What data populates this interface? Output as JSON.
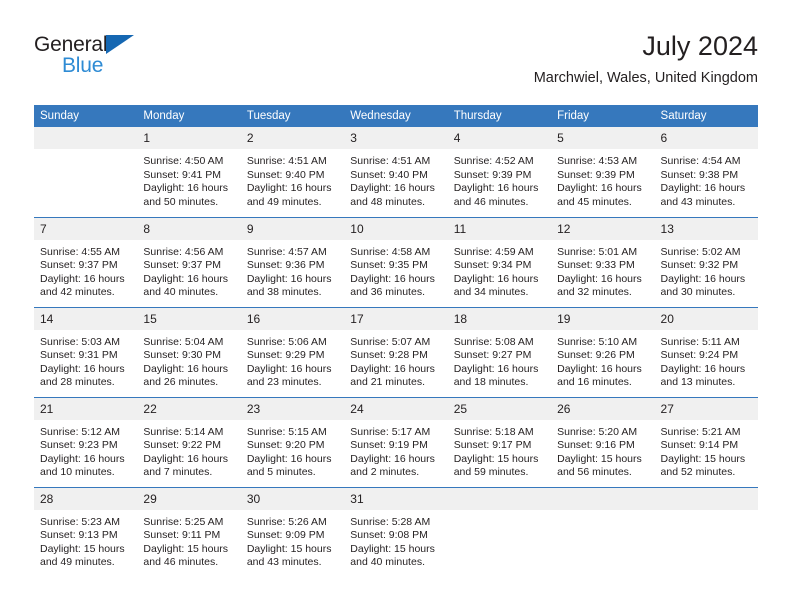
{
  "brand": {
    "name_top": "General",
    "name_bottom": "Blue",
    "triangle_color": "#1567b2",
    "blue_text_color": "#2e8bd4"
  },
  "header": {
    "month_year": "July 2024",
    "location": "Marchwiel, Wales, United Kingdom"
  },
  "theme": {
    "header_bg": "#3678bd",
    "header_text": "#ffffff",
    "daynum_bg": "#f0f0f0",
    "cell_bg": "#ffffff",
    "text": "#231f20",
    "row_divider": "#3678bd"
  },
  "weekday_headers": [
    "Sunday",
    "Monday",
    "Tuesday",
    "Wednesday",
    "Thursday",
    "Friday",
    "Saturday"
  ],
  "weeks": [
    {
      "days": [
        {
          "day": "",
          "sunrise": "",
          "sunset": "",
          "daylight_1": "",
          "daylight_2": "",
          "blank": true
        },
        {
          "day": "1",
          "sunrise": "Sunrise: 4:50 AM",
          "sunset": "Sunset: 9:41 PM",
          "daylight_1": "Daylight: 16 hours",
          "daylight_2": "and 50 minutes."
        },
        {
          "day": "2",
          "sunrise": "Sunrise: 4:51 AM",
          "sunset": "Sunset: 9:40 PM",
          "daylight_1": "Daylight: 16 hours",
          "daylight_2": "and 49 minutes."
        },
        {
          "day": "3",
          "sunrise": "Sunrise: 4:51 AM",
          "sunset": "Sunset: 9:40 PM",
          "daylight_1": "Daylight: 16 hours",
          "daylight_2": "and 48 minutes."
        },
        {
          "day": "4",
          "sunrise": "Sunrise: 4:52 AM",
          "sunset": "Sunset: 9:39 PM",
          "daylight_1": "Daylight: 16 hours",
          "daylight_2": "and 46 minutes."
        },
        {
          "day": "5",
          "sunrise": "Sunrise: 4:53 AM",
          "sunset": "Sunset: 9:39 PM",
          "daylight_1": "Daylight: 16 hours",
          "daylight_2": "and 45 minutes."
        },
        {
          "day": "6",
          "sunrise": "Sunrise: 4:54 AM",
          "sunset": "Sunset: 9:38 PM",
          "daylight_1": "Daylight: 16 hours",
          "daylight_2": "and 43 minutes."
        }
      ]
    },
    {
      "days": [
        {
          "day": "7",
          "sunrise": "Sunrise: 4:55 AM",
          "sunset": "Sunset: 9:37 PM",
          "daylight_1": "Daylight: 16 hours",
          "daylight_2": "and 42 minutes."
        },
        {
          "day": "8",
          "sunrise": "Sunrise: 4:56 AM",
          "sunset": "Sunset: 9:37 PM",
          "daylight_1": "Daylight: 16 hours",
          "daylight_2": "and 40 minutes."
        },
        {
          "day": "9",
          "sunrise": "Sunrise: 4:57 AM",
          "sunset": "Sunset: 9:36 PM",
          "daylight_1": "Daylight: 16 hours",
          "daylight_2": "and 38 minutes."
        },
        {
          "day": "10",
          "sunrise": "Sunrise: 4:58 AM",
          "sunset": "Sunset: 9:35 PM",
          "daylight_1": "Daylight: 16 hours",
          "daylight_2": "and 36 minutes."
        },
        {
          "day": "11",
          "sunrise": "Sunrise: 4:59 AM",
          "sunset": "Sunset: 9:34 PM",
          "daylight_1": "Daylight: 16 hours",
          "daylight_2": "and 34 minutes."
        },
        {
          "day": "12",
          "sunrise": "Sunrise: 5:01 AM",
          "sunset": "Sunset: 9:33 PM",
          "daylight_1": "Daylight: 16 hours",
          "daylight_2": "and 32 minutes."
        },
        {
          "day": "13",
          "sunrise": "Sunrise: 5:02 AM",
          "sunset": "Sunset: 9:32 PM",
          "daylight_1": "Daylight: 16 hours",
          "daylight_2": "and 30 minutes."
        }
      ]
    },
    {
      "days": [
        {
          "day": "14",
          "sunrise": "Sunrise: 5:03 AM",
          "sunset": "Sunset: 9:31 PM",
          "daylight_1": "Daylight: 16 hours",
          "daylight_2": "and 28 minutes."
        },
        {
          "day": "15",
          "sunrise": "Sunrise: 5:04 AM",
          "sunset": "Sunset: 9:30 PM",
          "daylight_1": "Daylight: 16 hours",
          "daylight_2": "and 26 minutes."
        },
        {
          "day": "16",
          "sunrise": "Sunrise: 5:06 AM",
          "sunset": "Sunset: 9:29 PM",
          "daylight_1": "Daylight: 16 hours",
          "daylight_2": "and 23 minutes."
        },
        {
          "day": "17",
          "sunrise": "Sunrise: 5:07 AM",
          "sunset": "Sunset: 9:28 PM",
          "daylight_1": "Daylight: 16 hours",
          "daylight_2": "and 21 minutes."
        },
        {
          "day": "18",
          "sunrise": "Sunrise: 5:08 AM",
          "sunset": "Sunset: 9:27 PM",
          "daylight_1": "Daylight: 16 hours",
          "daylight_2": "and 18 minutes."
        },
        {
          "day": "19",
          "sunrise": "Sunrise: 5:10 AM",
          "sunset": "Sunset: 9:26 PM",
          "daylight_1": "Daylight: 16 hours",
          "daylight_2": "and 16 minutes."
        },
        {
          "day": "20",
          "sunrise": "Sunrise: 5:11 AM",
          "sunset": "Sunset: 9:24 PM",
          "daylight_1": "Daylight: 16 hours",
          "daylight_2": "and 13 minutes."
        }
      ]
    },
    {
      "days": [
        {
          "day": "21",
          "sunrise": "Sunrise: 5:12 AM",
          "sunset": "Sunset: 9:23 PM",
          "daylight_1": "Daylight: 16 hours",
          "daylight_2": "and 10 minutes."
        },
        {
          "day": "22",
          "sunrise": "Sunrise: 5:14 AM",
          "sunset": "Sunset: 9:22 PM",
          "daylight_1": "Daylight: 16 hours",
          "daylight_2": "and 7 minutes."
        },
        {
          "day": "23",
          "sunrise": "Sunrise: 5:15 AM",
          "sunset": "Sunset: 9:20 PM",
          "daylight_1": "Daylight: 16 hours",
          "daylight_2": "and 5 minutes."
        },
        {
          "day": "24",
          "sunrise": "Sunrise: 5:17 AM",
          "sunset": "Sunset: 9:19 PM",
          "daylight_1": "Daylight: 16 hours",
          "daylight_2": "and 2 minutes."
        },
        {
          "day": "25",
          "sunrise": "Sunrise: 5:18 AM",
          "sunset": "Sunset: 9:17 PM",
          "daylight_1": "Daylight: 15 hours",
          "daylight_2": "and 59 minutes."
        },
        {
          "day": "26",
          "sunrise": "Sunrise: 5:20 AM",
          "sunset": "Sunset: 9:16 PM",
          "daylight_1": "Daylight: 15 hours",
          "daylight_2": "and 56 minutes."
        },
        {
          "day": "27",
          "sunrise": "Sunrise: 5:21 AM",
          "sunset": "Sunset: 9:14 PM",
          "daylight_1": "Daylight: 15 hours",
          "daylight_2": "and 52 minutes."
        }
      ]
    },
    {
      "days": [
        {
          "day": "28",
          "sunrise": "Sunrise: 5:23 AM",
          "sunset": "Sunset: 9:13 PM",
          "daylight_1": "Daylight: 15 hours",
          "daylight_2": "and 49 minutes."
        },
        {
          "day": "29",
          "sunrise": "Sunrise: 5:25 AM",
          "sunset": "Sunset: 9:11 PM",
          "daylight_1": "Daylight: 15 hours",
          "daylight_2": "and 46 minutes."
        },
        {
          "day": "30",
          "sunrise": "Sunrise: 5:26 AM",
          "sunset": "Sunset: 9:09 PM",
          "daylight_1": "Daylight: 15 hours",
          "daylight_2": "and 43 minutes."
        },
        {
          "day": "31",
          "sunrise": "Sunrise: 5:28 AM",
          "sunset": "Sunset: 9:08 PM",
          "daylight_1": "Daylight: 15 hours",
          "daylight_2": "and 40 minutes."
        },
        {
          "day": "",
          "sunrise": "",
          "sunset": "",
          "daylight_1": "",
          "daylight_2": "",
          "blank": true
        },
        {
          "day": "",
          "sunrise": "",
          "sunset": "",
          "daylight_1": "",
          "daylight_2": "",
          "blank": true
        },
        {
          "day": "",
          "sunrise": "",
          "sunset": "",
          "daylight_1": "",
          "daylight_2": "",
          "blank": true
        }
      ]
    }
  ]
}
